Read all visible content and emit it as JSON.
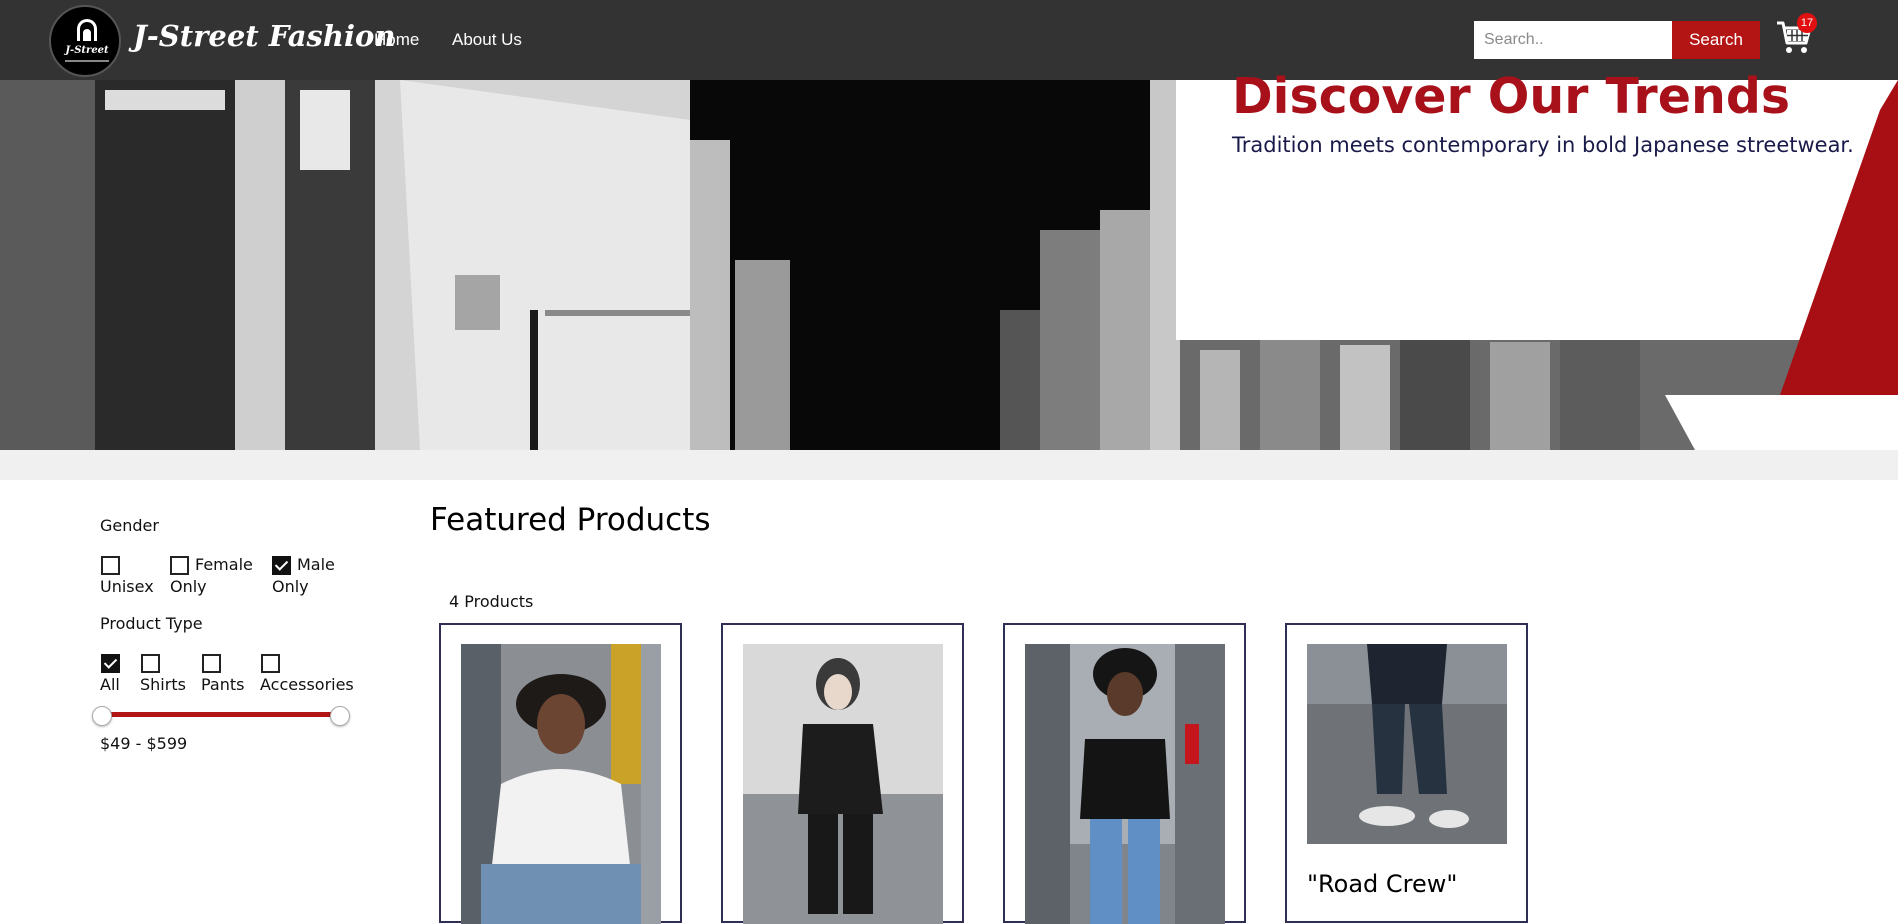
{
  "nav": {
    "logo_text": "J-Street",
    "brand": "J-Street Fashion",
    "links": [
      "Home",
      "About Us"
    ],
    "search_placeholder": "Search..",
    "search_button": "Search",
    "cart_count": "17"
  },
  "hero": {
    "title": "Discover Our Trends",
    "subtitle": "Tradition meets contemporary in bold Japanese streetwear."
  },
  "filters": {
    "gender_title": "Gender",
    "gender_options": [
      {
        "line1": "",
        "line2": "Unisex",
        "checked": false
      },
      {
        "line1": "Female",
        "line2": "Only",
        "checked": false
      },
      {
        "line1": "Male",
        "line2": "Only",
        "checked": true
      }
    ],
    "type_title": "Product Type",
    "type_options": [
      {
        "label": "All",
        "checked": true
      },
      {
        "label": "Shirts",
        "checked": false
      },
      {
        "label": "Pants",
        "checked": false
      },
      {
        "label": "Accessories",
        "checked": false
      }
    ],
    "price_range": "$49 - $599"
  },
  "main": {
    "title": "Featured Products",
    "count": "4 Products",
    "products": [
      {
        "name": ""
      },
      {
        "name": ""
      },
      {
        "name": ""
      },
      {
        "name": "\"Road Crew\""
      }
    ]
  },
  "colors": {
    "nav_bg": "#333333",
    "accent_red": "#b31515",
    "title_red": "#a8111a"
  }
}
